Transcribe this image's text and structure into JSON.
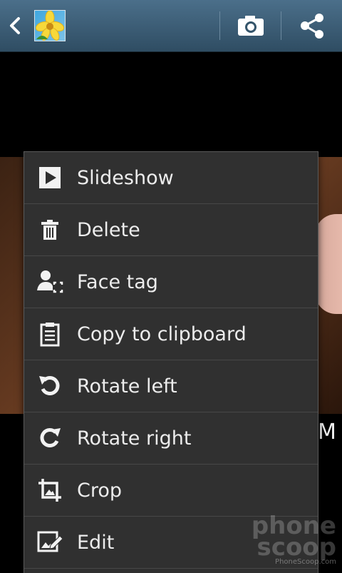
{
  "header": {
    "back_label": "Back",
    "icons": [
      "back-icon",
      "gallery-thumbnail",
      "camera-icon",
      "share-icon"
    ]
  },
  "background": {
    "partial_text": "M"
  },
  "watermark": {
    "line1": "phone",
    "line2": "scoop",
    "small": "PhoneScoop.com"
  },
  "menu": {
    "items": [
      {
        "label": "Slideshow",
        "icon": "play-icon"
      },
      {
        "label": "Delete",
        "icon": "trash-icon"
      },
      {
        "label": "Face tag",
        "icon": "face-tag-icon"
      },
      {
        "label": "Copy to clipboard",
        "icon": "clipboard-icon"
      },
      {
        "label": "Rotate left",
        "icon": "rotate-left-icon"
      },
      {
        "label": "Rotate right",
        "icon": "rotate-right-icon"
      },
      {
        "label": "Crop",
        "icon": "crop-icon"
      },
      {
        "label": "Edit",
        "icon": "edit-icon"
      }
    ]
  }
}
